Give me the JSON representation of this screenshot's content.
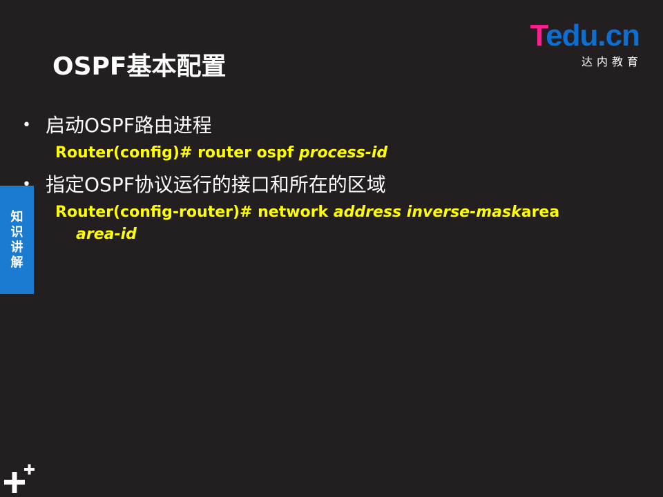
{
  "logo": {
    "mark_first": "T",
    "mark_rest": "edu.cn",
    "subtitle": "达内教育"
  },
  "title": "OSPF基本配置",
  "side_tab": "知识讲解",
  "bullets": [
    {
      "text": "启动OSPF路由进程",
      "command_lines": [
        {
          "plain": "Router(config)# router ospf ",
          "italic": "process-id"
        }
      ]
    },
    {
      "text": "指定OSPF协议运行的接口和所在的区域",
      "command_lines": [
        {
          "plain": "Router(config-router)# network ",
          "italic": "address inverse-mask",
          "trail": "area"
        },
        {
          "italic": "area-id"
        }
      ]
    }
  ],
  "colors": {
    "background": "#231f20",
    "command": "#ffff00",
    "tab": "#1b7bd1",
    "logo_pink": "#ff1f8e",
    "logo_blue": "#0d6fd1"
  },
  "icons": {
    "bullet": "•",
    "corner": "plus-icon"
  }
}
